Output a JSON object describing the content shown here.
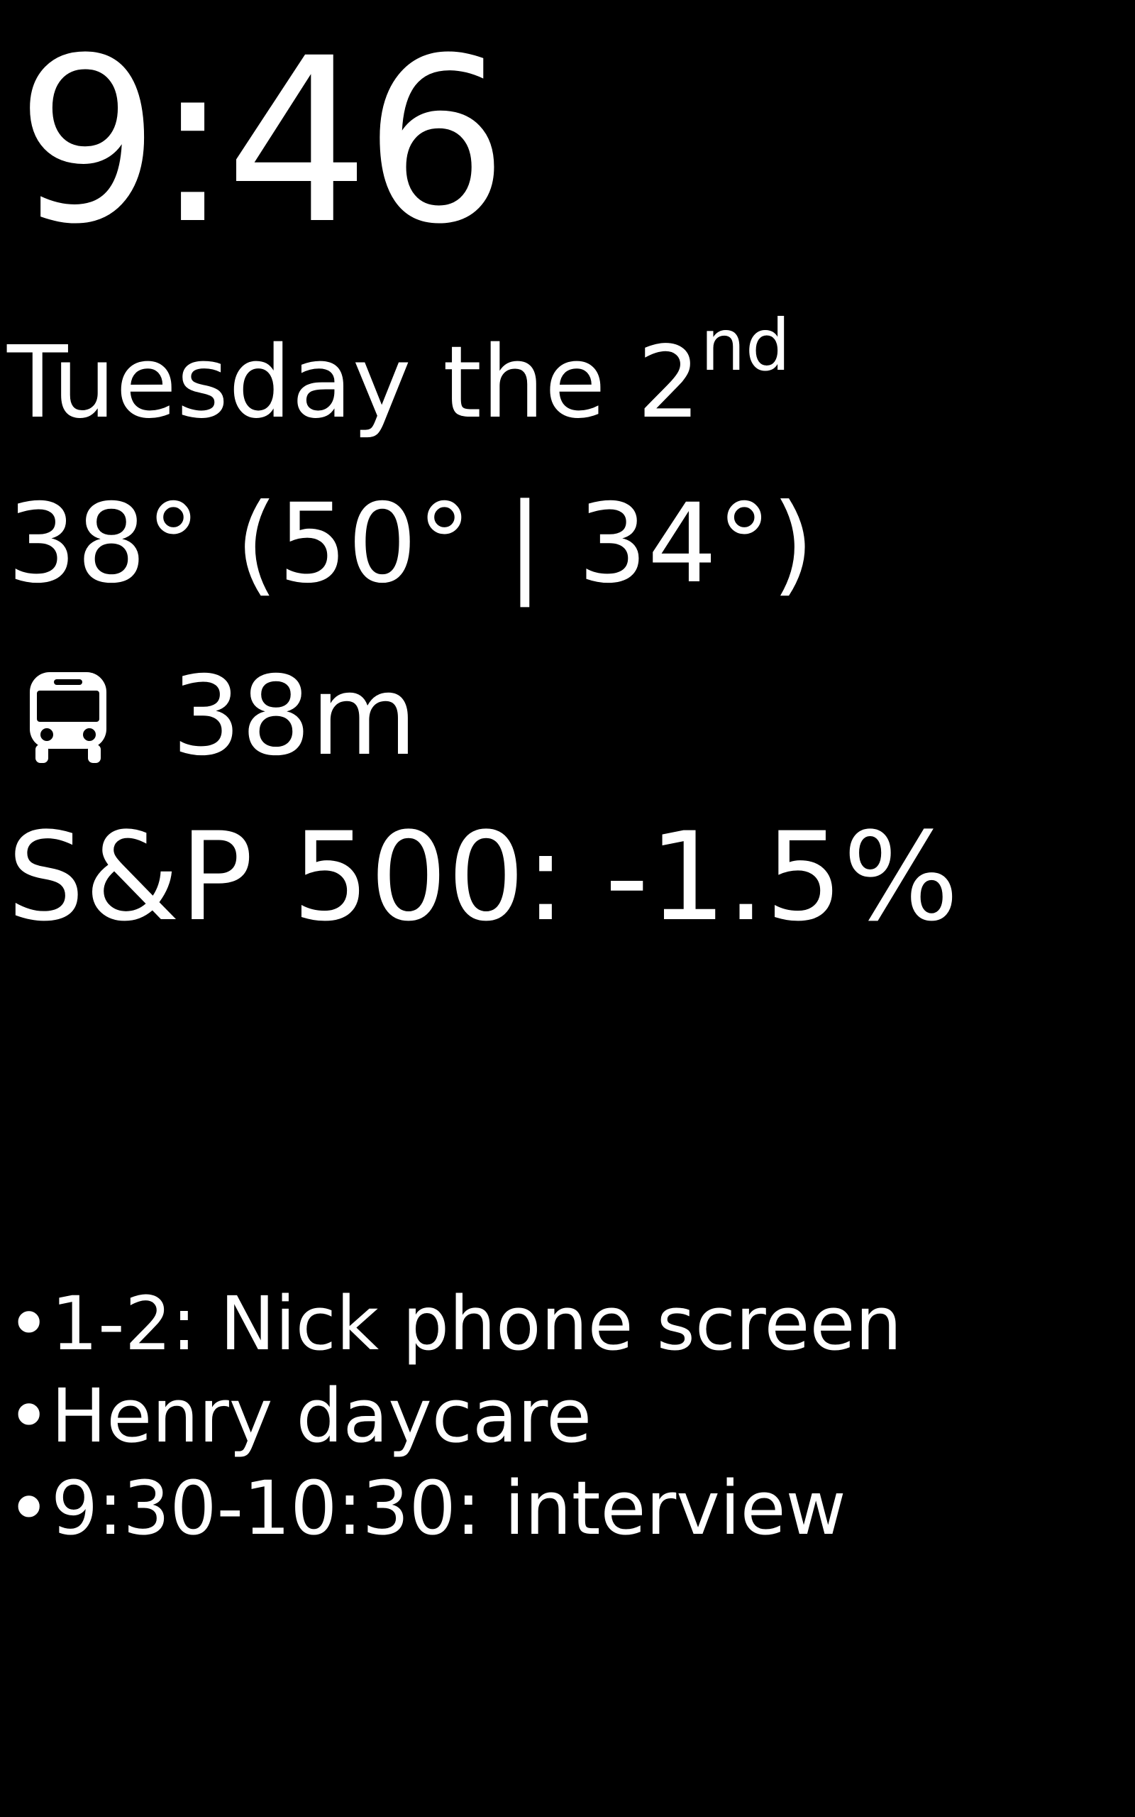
{
  "clock": {
    "time": "9:46"
  },
  "date": {
    "text": "Tuesday the 2",
    "suffix": "nd"
  },
  "weather": {
    "text": "38° (50° | 34°)"
  },
  "transit": {
    "icon": "bus-icon",
    "eta": "38m"
  },
  "stock": {
    "text": "S&P 500: -1.5%"
  },
  "events": {
    "bullet": "•",
    "items": [
      {
        "text": "1-2: Nick phone screen"
      },
      {
        "text": "Henry daycare"
      },
      {
        "text": "9:30-10:30: interview"
      }
    ]
  },
  "colors": {
    "background": "#000000",
    "foreground": "#ffffff"
  }
}
